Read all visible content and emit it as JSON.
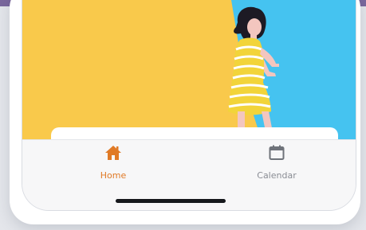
{
  "tabs": [
    {
      "label": "Home",
      "icon": "home-icon",
      "active": true,
      "color": "#e07a26"
    },
    {
      "label": "Calendar",
      "icon": "calendar-icon",
      "active": false,
      "color": "#8a8d94"
    }
  ],
  "illustration": {
    "icon": "woman-walking-illustration",
    "colors": {
      "yellow": "#f9c94b",
      "blue": "#45c3f0",
      "dress": "#f2d43a"
    }
  }
}
